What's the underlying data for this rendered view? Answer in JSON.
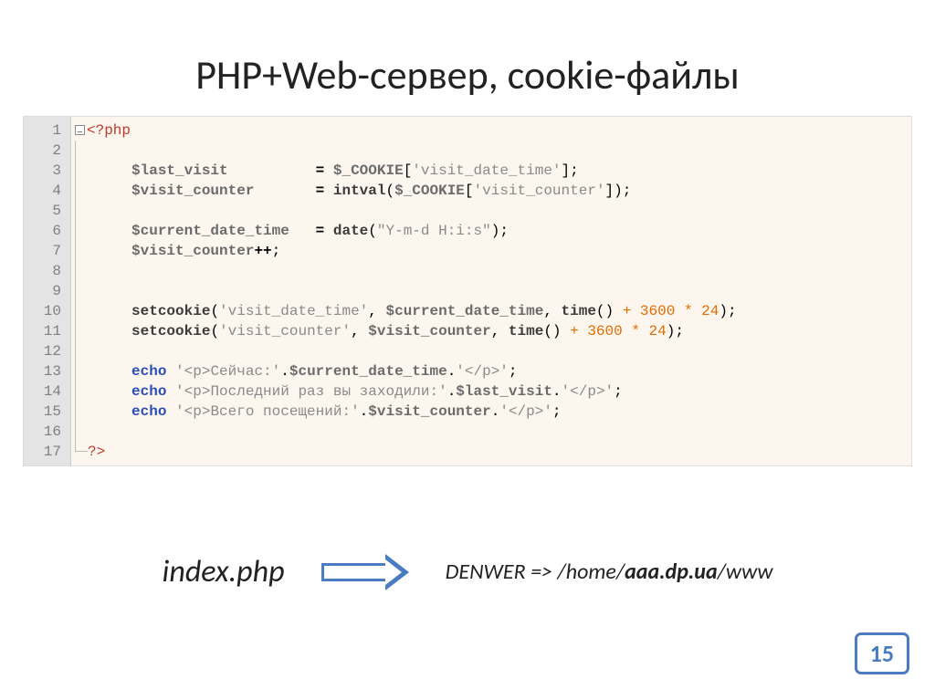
{
  "title": "PHP+Web-сервер, cookie-файлы",
  "code": {
    "lines": [
      1,
      2,
      3,
      4,
      5,
      6,
      7,
      8,
      9,
      10,
      11,
      12,
      13,
      14,
      15,
      16,
      17
    ],
    "open_tag": "<?php",
    "close_tag": "?>",
    "l3_var": "$last_visit",
    "l3_glob": "$_COOKIE",
    "l3_key": "'visit_date_time'",
    "l4_var": "$visit_counter",
    "l4_func": "intval",
    "l4_glob": "$_COOKIE",
    "l4_key": "'visit_counter'",
    "l6_var": "$current_date_time",
    "l6_func": "date",
    "l6_arg": "\"Y-m-d H:i:s\"",
    "l7_var": "$visit_counter",
    "l7_op": "++",
    "l10_func": "setcookie",
    "l10_key": "'visit_date_time'",
    "l10_val": "$current_date_time",
    "l10_time": "time",
    "l10_expr": " + 3600 * 24",
    "l11_func": "setcookie",
    "l11_key": "'visit_counter'",
    "l11_val": "$visit_counter",
    "l11_time": "time",
    "l11_expr": " + 3600 * 24",
    "echo": "echo",
    "l13_s1": "'<p>Сейчас:'",
    "l13_v": "$current_date_time",
    "l13_s2": "'</p>'",
    "l14_s1": "'<p>Последний раз вы заходили:'",
    "l14_v": "$last_visit",
    "l14_s2": "'</p>'",
    "l15_s1": "'<p>Всего посещений:'",
    "l15_v": "$visit_counter",
    "l15_s2": "'</p>'"
  },
  "footer": {
    "filename": "index.php",
    "denwer_prefix": "DENWER => /home/",
    "denwer_domain": "aaa.dp.ua",
    "denwer_suffix": "/www"
  },
  "page_number": "15"
}
